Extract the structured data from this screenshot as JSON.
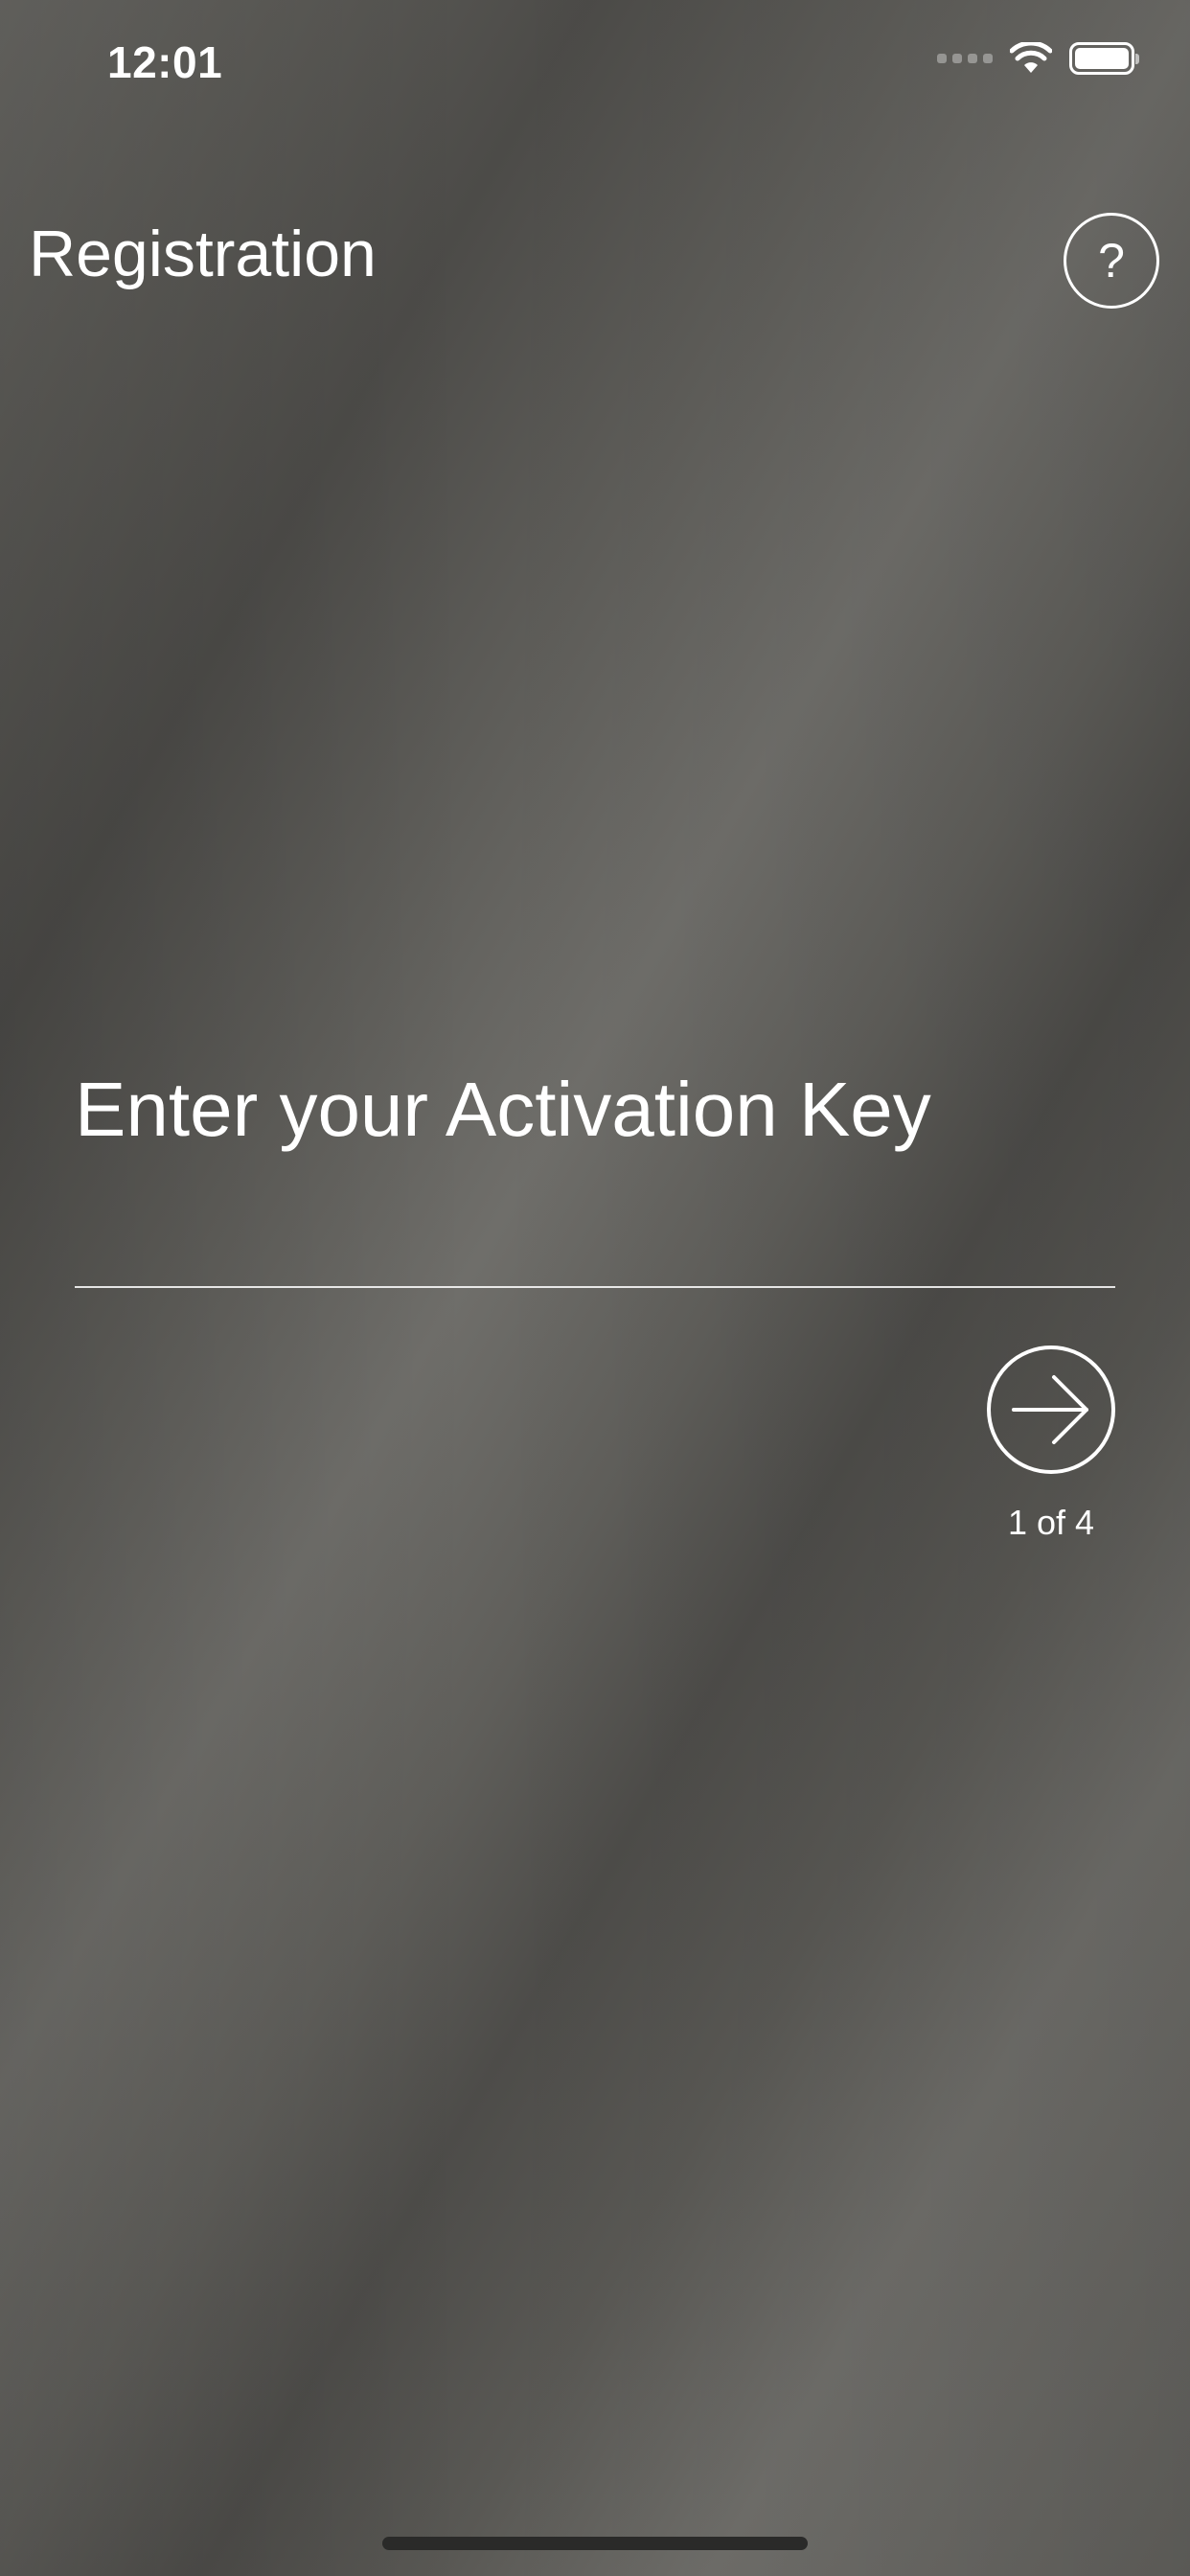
{
  "status_bar": {
    "time": "12:01",
    "icons": [
      "cellular-signal-icon",
      "wifi-icon",
      "battery-icon"
    ]
  },
  "header": {
    "title": "Registration",
    "help_label": "?"
  },
  "main": {
    "prompt": "Enter your Activation Key",
    "input": {
      "value": "",
      "placeholder": ""
    },
    "next_icon": "arrow-right-icon",
    "step": "1 of 4"
  },
  "colors": {
    "text": "#ffffff",
    "background_dark": "#4a4946",
    "background_light": "#6f6e6a"
  }
}
